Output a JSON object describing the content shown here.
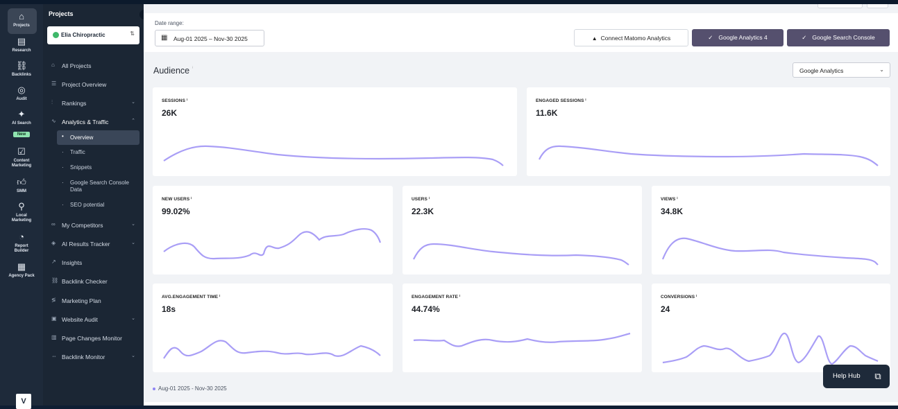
{
  "rail": {
    "items": [
      {
        "label": "Projects",
        "icon": "home-icon"
      },
      {
        "label": "Research",
        "icon": "research-icon"
      },
      {
        "label": "Backlinks",
        "icon": "link-icon"
      },
      {
        "label": "Audit",
        "icon": "audit-icon"
      },
      {
        "label": "AI Search",
        "icon": "sparkle-icon",
        "badge": "New"
      },
      {
        "label": "Content Marketing",
        "icon": "content-icon"
      },
      {
        "label": "SMM",
        "icon": "thumbs-up-icon"
      },
      {
        "label": "Local Marketing",
        "icon": "pin-icon"
      },
      {
        "label": "Report Builder",
        "icon": "report-icon"
      },
      {
        "label": "Agency Pack",
        "icon": "building-icon"
      }
    ],
    "logo": "V"
  },
  "nav": {
    "title": "Projects",
    "project": "Elia Chiropractic",
    "items": [
      {
        "label": "All Projects"
      },
      {
        "label": "Project Overview"
      },
      {
        "label": "Rankings"
      },
      {
        "label": "Analytics & Traffic"
      },
      {
        "label": "My Competitors"
      },
      {
        "label": "AI Results Tracker"
      },
      {
        "label": "Insights"
      },
      {
        "label": "Backlink Checker"
      },
      {
        "label": "Marketing Plan"
      },
      {
        "label": "Website Audit"
      },
      {
        "label": "Page Changes Monitor"
      },
      {
        "label": "Backlink Monitor"
      }
    ],
    "sub_items": [
      {
        "label": "Overview"
      },
      {
        "label": "Traffic"
      },
      {
        "label": "Snippets"
      },
      {
        "label": "Google Search Console Data"
      },
      {
        "label": "SEO potential"
      }
    ]
  },
  "header": {
    "date_range_label": "Date range:",
    "date_range_value": "Aug-01 2025 – Nov-30 2025",
    "connect_matomo": "Connect Matomo Analytics",
    "ga4": "Google Analytics 4",
    "gsc": "Google Search Console"
  },
  "audience": {
    "title": "Audience",
    "source": "Google Analytics"
  },
  "cards": [
    {
      "label": "SESSIONS",
      "value": "26K"
    },
    {
      "label": "ENGAGED SESSIONS",
      "value": "11.6K"
    },
    {
      "label": "NEW USERS",
      "value": "99.02%"
    },
    {
      "label": "USERS",
      "value": "22.3K"
    },
    {
      "label": "VIEWS",
      "value": "34.8K"
    },
    {
      "label": "AVG.ENGAGEMENT TIME",
      "value": "18s"
    },
    {
      "label": "ENGAGEMENT RATE",
      "value": "44.74%"
    },
    {
      "label": "CONVERSIONS",
      "value": "24"
    }
  ],
  "legend": "Aug-01 2025 - Nov-30 2025",
  "help": "Help Hub",
  "colors": {
    "line": "#a99ef6",
    "accent_button": "#55506e",
    "sidebar": "#1e2a3a"
  }
}
